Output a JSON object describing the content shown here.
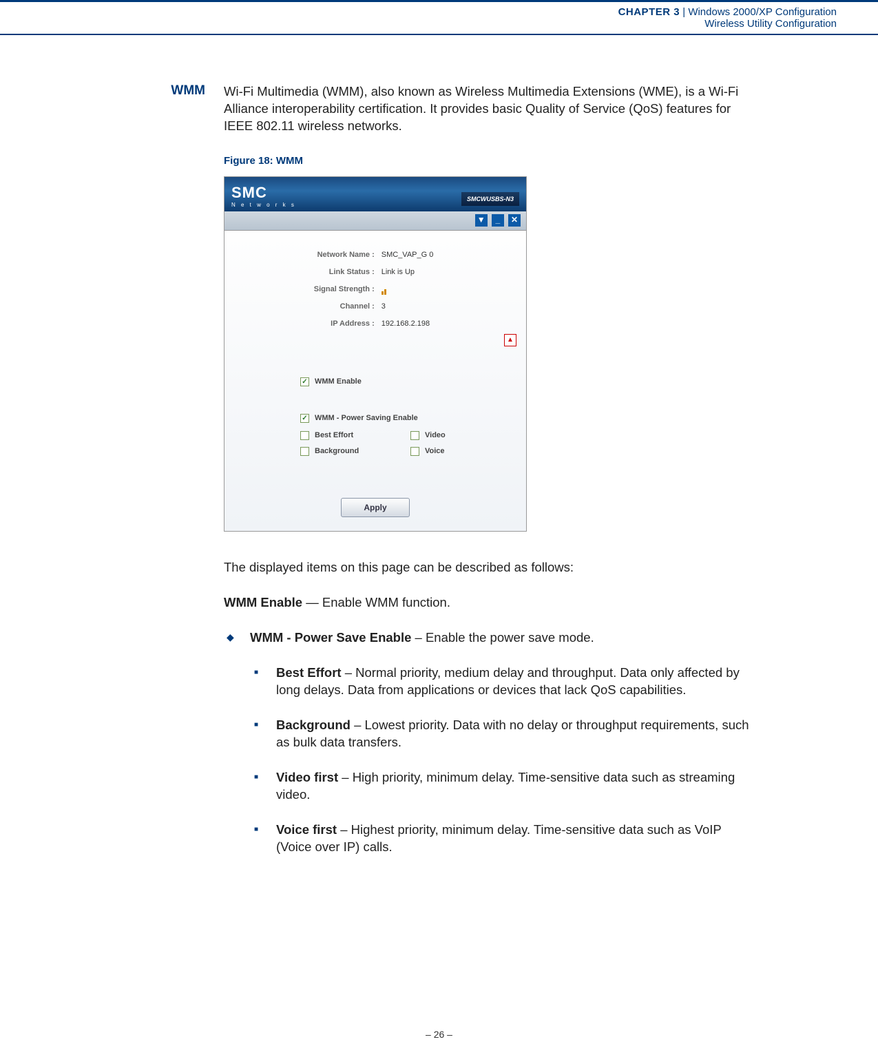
{
  "header": {
    "chapter_bold": "CHAPTER 3",
    "chapter_sep": "  |  ",
    "chapter_title": "Windows 2000/XP Configuration",
    "subtitle": "Wireless Utility Configuration"
  },
  "section": {
    "heading": "WMM",
    "intro": "Wi-Fi Multimedia (WMM), also known as Wireless Multimedia Extensions (WME), is a Wi-Fi Alliance interoperability certification. It provides basic Quality of Service (QoS) features for IEEE 802.11 wireless networks.",
    "fig_caption": "Figure 18:  WMM"
  },
  "window": {
    "logo_main": "SMC",
    "logo_sub": "N e t w o r k s",
    "model": "SMCWUSBS-N3",
    "rows": [
      {
        "label": "Network Name :",
        "value": "SMC_VAP_G 0"
      },
      {
        "label": "Link Status :",
        "value": "Link is Up"
      },
      {
        "label": "Signal Strength :",
        "value": ""
      },
      {
        "label": "Channel :",
        "value": "3"
      },
      {
        "label": "IP Address :",
        "value": "192.168.2.198"
      }
    ],
    "toggle_glyph": "▲",
    "btn_down": "▼",
    "btn_min": "_",
    "btn_close": "✕",
    "wmm_enable": "WMM Enable",
    "wmm_ps": "WMM - Power Saving Enable",
    "best_effort": "Best Effort",
    "video": "Video",
    "background": "Background",
    "voice": "Voice",
    "check_glyph": "✓",
    "apply": "Apply"
  },
  "desc": {
    "intro": "The displayed items on this page can be described as follows:",
    "wmm_enable_bold": "WMM Enable",
    "wmm_enable_rest": " — Enable WMM function.",
    "l1_bold": "WMM - Power Save Enable",
    "l1_rest": " – Enable the power save mode.",
    "items": [
      {
        "bold": "Best Effort",
        "rest": " – Normal priority, medium delay and throughput. Data only affected by long delays. Data from applications or devices that lack QoS capabilities."
      },
      {
        "bold": "Background",
        "rest": " – Lowest priority. Data with no delay or throughput requirements, such as bulk data transfers."
      },
      {
        "bold": "Video first",
        "rest": " – High priority, minimum delay. Time-sensitive data such as streaming video."
      },
      {
        "bold": "Voice first",
        "rest": " – Highest priority, minimum delay. Time-sensitive data such as VoIP (Voice over IP) calls."
      }
    ]
  },
  "footer": "–  26  –"
}
